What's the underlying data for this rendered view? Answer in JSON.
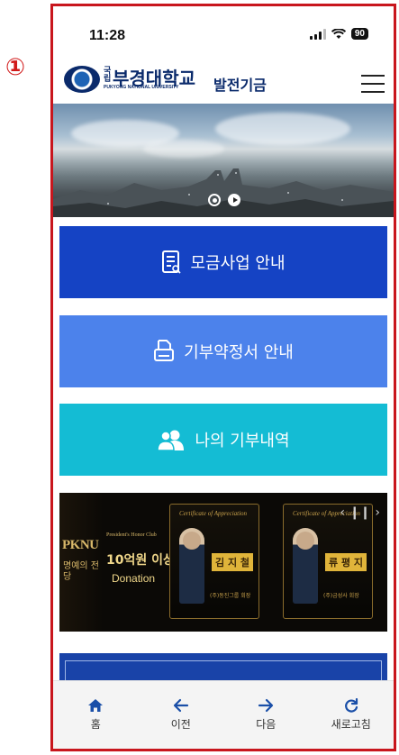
{
  "annotation": {
    "step_marker": "①"
  },
  "status_bar": {
    "time": "11:28",
    "battery": "90"
  },
  "header": {
    "logo_small": "국립",
    "logo_main": "부경대학교",
    "logo_sub": "PUKYONG NATIONAL UNIVERSITY",
    "logo_fund": "발전기금"
  },
  "menu_buttons": [
    {
      "label": "모금사업 안내",
      "icon": "document-list-icon",
      "color": "#1543c4"
    },
    {
      "label": "기부약정서 안내",
      "icon": "printer-icon",
      "color": "#4c82eb"
    },
    {
      "label": "나의 기부내역",
      "icon": "users-icon",
      "color": "#14bcd4"
    }
  ],
  "honor_banner": {
    "brand": "PKNU",
    "vertical_text": "명예의 전당",
    "club": "President's Honor Club",
    "amount": "10억원 이상",
    "donation": "Donation",
    "cards": [
      {
        "cert": "Certificate of Appreciation",
        "name": "김 지 철",
        "role": "(주)동진그룹 회장"
      },
      {
        "cert": "Certificate of Appreciation",
        "name": "류 평 지",
        "role": "(주)금성사 회장"
      }
    ]
  },
  "bottom_nav": [
    {
      "label": "홈",
      "icon": "home-icon"
    },
    {
      "label": "이전",
      "icon": "arrow-left-icon"
    },
    {
      "label": "다음",
      "icon": "arrow-right-icon"
    },
    {
      "label": "새로고침",
      "icon": "refresh-icon"
    }
  ],
  "colors": {
    "frame_border": "#c8161d",
    "brand_navy": "#0a2a6b",
    "nav_icon": "#1a4fa8"
  }
}
